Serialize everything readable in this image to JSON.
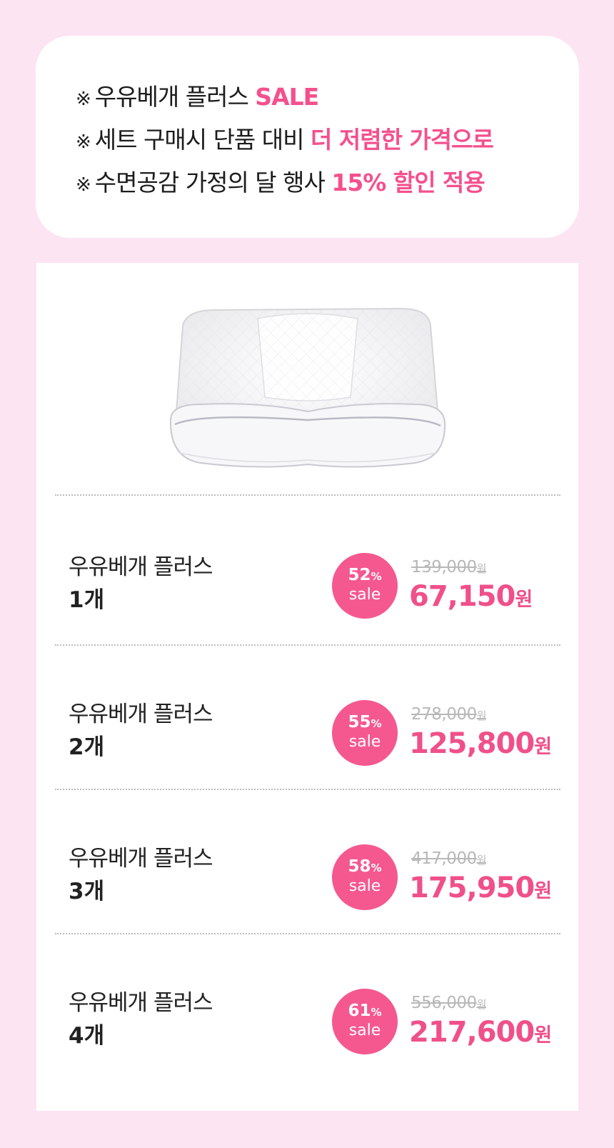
{
  "notice": {
    "mark": "※",
    "lines": [
      {
        "text": "우유베개 플러스 ",
        "highlight": "SALE"
      },
      {
        "text": "세트 구매시 단품 대비 ",
        "highlight": "더 저렴한 가격으로"
      },
      {
        "text": "수면공감 가정의 달 행사 ",
        "highlight": "15% 할인 적용"
      }
    ]
  },
  "product": {
    "image_icon": "pillow-illustration",
    "options": [
      {
        "name": "우유베개 플러스",
        "qty": "1개",
        "discount": "52",
        "pct_sign": "%",
        "sale": "sale",
        "original": "139,000",
        "price": "67,150",
        "unit": "원"
      },
      {
        "name": "우유베개 플러스",
        "qty": "2개",
        "discount": "55",
        "pct_sign": "%",
        "sale": "sale",
        "original": "278,000",
        "price": "125,800",
        "unit": "원"
      },
      {
        "name": "우유베개 플러스",
        "qty": "3개",
        "discount": "58",
        "pct_sign": "%",
        "sale": "sale",
        "original": "417,000",
        "price": "175,950",
        "unit": "원"
      },
      {
        "name": "우유베개 플러스",
        "qty": "4개",
        "discount": "61",
        "pct_sign": "%",
        "sale": "sale",
        "original": "556,000",
        "price": "217,600",
        "unit": "원"
      }
    ]
  },
  "colors": {
    "background": "#fde4f2",
    "accent": "#f5508e",
    "badge": "#f5588f",
    "strike": "#b8b8b8"
  }
}
